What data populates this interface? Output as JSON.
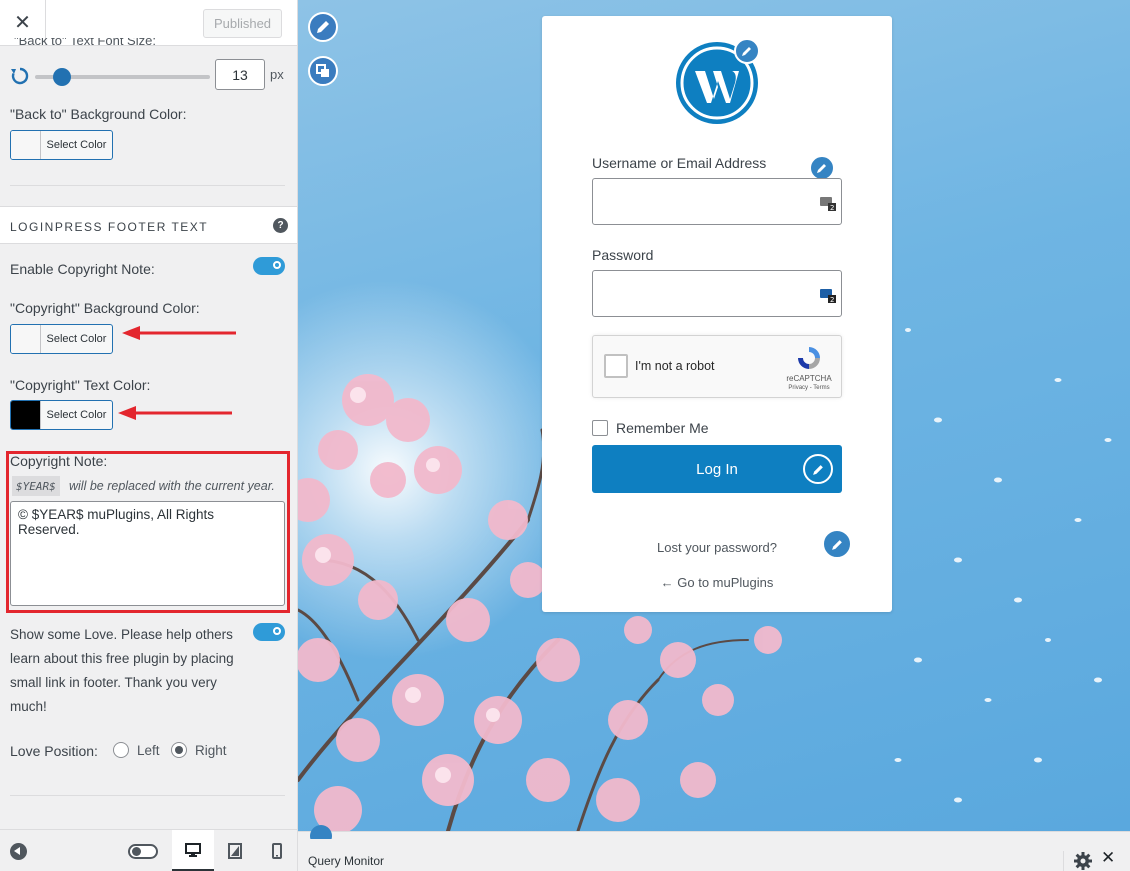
{
  "sidebar": {
    "close_glyph": "✕",
    "published_label": "Published",
    "cut_label": "\"Back to\" Text Font Size:",
    "font_size": {
      "value": "13",
      "unit": "px"
    },
    "back_bg_label": "\"Back to\" Background Color:",
    "select_color": "Select Color",
    "section_title": "LOGINPRESS FOOTER TEXT",
    "help_glyph": "?",
    "enable_copyright_label": "Enable Copyright Note:",
    "copyright_bg_label": "\"Copyright\" Background Color:",
    "copyright_text_label": "\"Copyright\" Text Color:",
    "copyright_note_label": "Copyright Note:",
    "year_tag": "$YEAR$",
    "year_desc": "will be replaced with the current year.",
    "copyright_note_value": "© $YEAR$ muPlugins, All Rights Reserved.",
    "love_text": "Show some Love. Please help others learn about this free plugin by placing small link in footer. Thank you very much!",
    "love_position_label": "Love Position:",
    "love_left": "Left",
    "love_right": "Right"
  },
  "login_form": {
    "username_label": "Username or Email Address",
    "password_label": "Password",
    "recaptcha_label": "I'm not a robot",
    "recaptcha_brand": "reCAPTCHA",
    "recaptcha_terms": "Privacy - Terms",
    "remember_label": "Remember Me",
    "login_button": "Log In",
    "lost_password": "Lost your password?",
    "go_to_site": "← Go to muPlugins"
  },
  "query_monitor": {
    "title": "Query Monitor",
    "close_glyph": "✕"
  },
  "colors": {
    "accent": "#2271b1",
    "toggle_on": "#2f9bd8",
    "login_button": "#0e7fc1",
    "annotation_red": "#e3262e",
    "edit_icon": "#3584c3"
  },
  "icons": {
    "close": "close-icon",
    "reset": "reset-icon",
    "help": "help-icon",
    "edit": "pencil-icon",
    "keyboard": "keyboard-icon",
    "settings": "gear-icon",
    "desktop": "desktop-icon",
    "tablet": "tablet-icon",
    "mobile": "mobile-icon"
  }
}
